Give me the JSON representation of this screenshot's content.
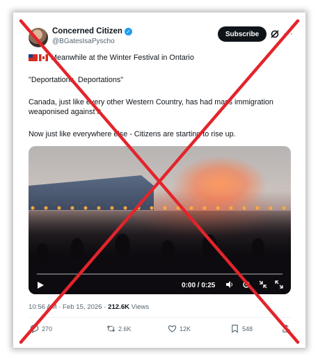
{
  "tweet": {
    "display_name": "Concerned Citizen",
    "handle": "@BGatesIsaPyscho",
    "subscribe_label": "Subscribe",
    "more_label": "···",
    "line1": "Meanwhile at the Winter Festival in Ontario",
    "line2": "\"Deportations, Deportations\"",
    "line3": "Canada, just like every other Western Country, has had mass immigration weaponised against it.",
    "line4": "Now just like everywhere else - Citizens are starting to rise up.",
    "video_time": "0:00 / 0:25",
    "timestamp": "10:56 AM · Feb 15, 2026 · ",
    "views_count": "212.6K",
    "views_label": " Views",
    "replies": "270",
    "reposts": "2.6K",
    "likes": "12K",
    "bookmarks": "548"
  },
  "colors": {
    "accent": "#1d9bf0",
    "text": "#0f1419",
    "muted": "#536471",
    "cross": "#e3242b"
  }
}
